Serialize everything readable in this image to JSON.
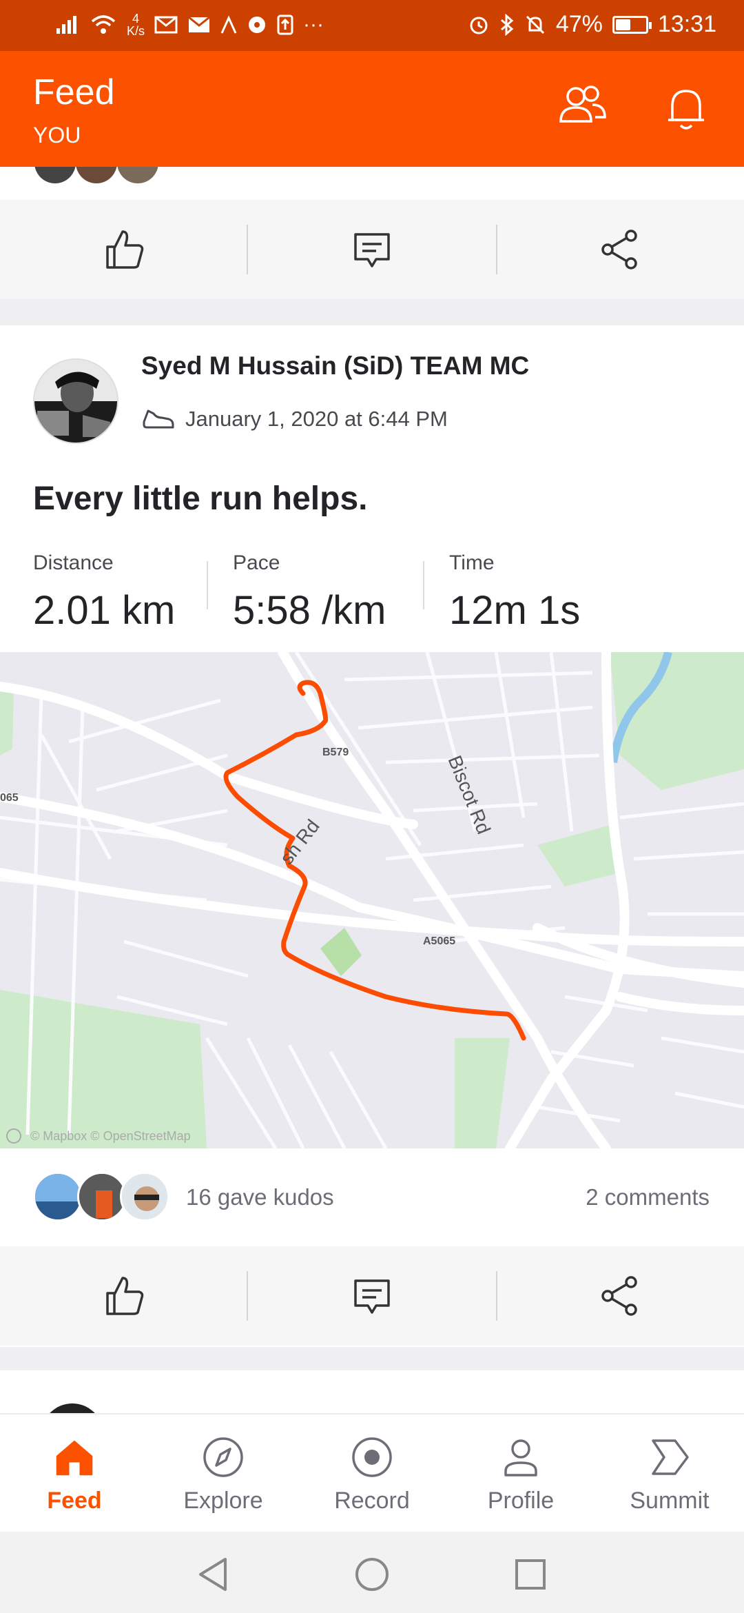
{
  "status_bar": {
    "net_speed": "4\nK/s",
    "battery": "47%",
    "battery_level": 0.47,
    "time": "13:31"
  },
  "header": {
    "title": "Feed",
    "subtitle": "YOU"
  },
  "post": {
    "athlete_name": "Syed M Hussain (SiD) TEAM MC",
    "date": "January 1, 2020 at 6:44 PM",
    "title": "Every little run helps.",
    "stats": [
      {
        "label": "Distance",
        "value": "2.01 km"
      },
      {
        "label": "Pace",
        "value": "5:58 /km"
      },
      {
        "label": "Time",
        "value": "12m 1s"
      }
    ],
    "map": {
      "labels": {
        "b579": "B579",
        "biscot": "Biscot Rd",
        "ash": "sh Rd",
        "a5065": "A5065",
        "left_cut": "065",
        "attribution": "© Mapbox © OpenStreetMap"
      },
      "route_color": "#fc4c02"
    },
    "kudos": "16 gave kudos",
    "comments": "2 comments"
  },
  "bottom_nav": {
    "items": [
      {
        "label": "Feed",
        "icon": "home-icon",
        "active": true
      },
      {
        "label": "Explore",
        "icon": "compass-icon",
        "active": false
      },
      {
        "label": "Record",
        "icon": "record-icon",
        "active": false
      },
      {
        "label": "Profile",
        "icon": "person-icon",
        "active": false
      },
      {
        "label": "Summit",
        "icon": "summit-icon",
        "active": false
      }
    ]
  },
  "colors": {
    "brand": "#fc5200",
    "status_bar": "#cc4100",
    "action_bar": "#f6f6f7"
  }
}
